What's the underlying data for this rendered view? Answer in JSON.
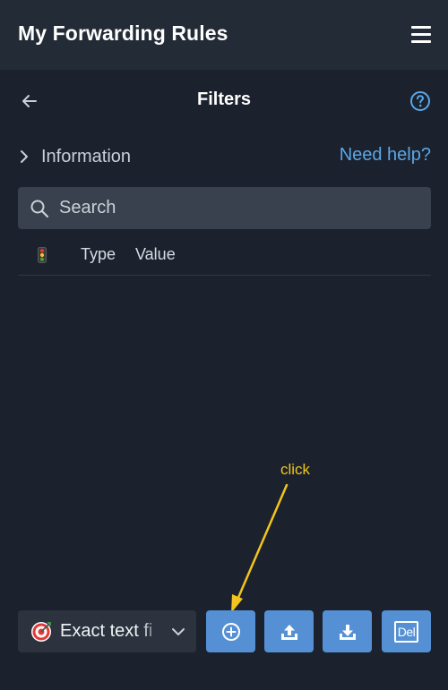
{
  "header": {
    "title": "My Forwarding Rules",
    "menu_icon": "hamburger-menu-icon"
  },
  "subheader": {
    "title": "Filters",
    "back_icon": "arrow-left-icon",
    "help_icon": "question-circle-icon"
  },
  "info": {
    "label": "Information",
    "help_link": "Need help?"
  },
  "search": {
    "placeholder": "Search",
    "value": ""
  },
  "table": {
    "status_icon": "traffic-light-icon",
    "columns": [
      "Type",
      "Value"
    ],
    "rows": []
  },
  "annotation": {
    "text": "click",
    "color": "#f2c41d"
  },
  "footer": {
    "filter_type": {
      "value": "Exact text fi",
      "icon": "target-icon"
    },
    "add_icon": "plus-circle-icon",
    "upload_icon": "upload-icon",
    "download_icon": "download-icon",
    "delete_label": "Del"
  },
  "colors": {
    "background": "#1b222d",
    "header": "#232b36",
    "accent": "#5490d3",
    "link": "#5aa6e8"
  }
}
